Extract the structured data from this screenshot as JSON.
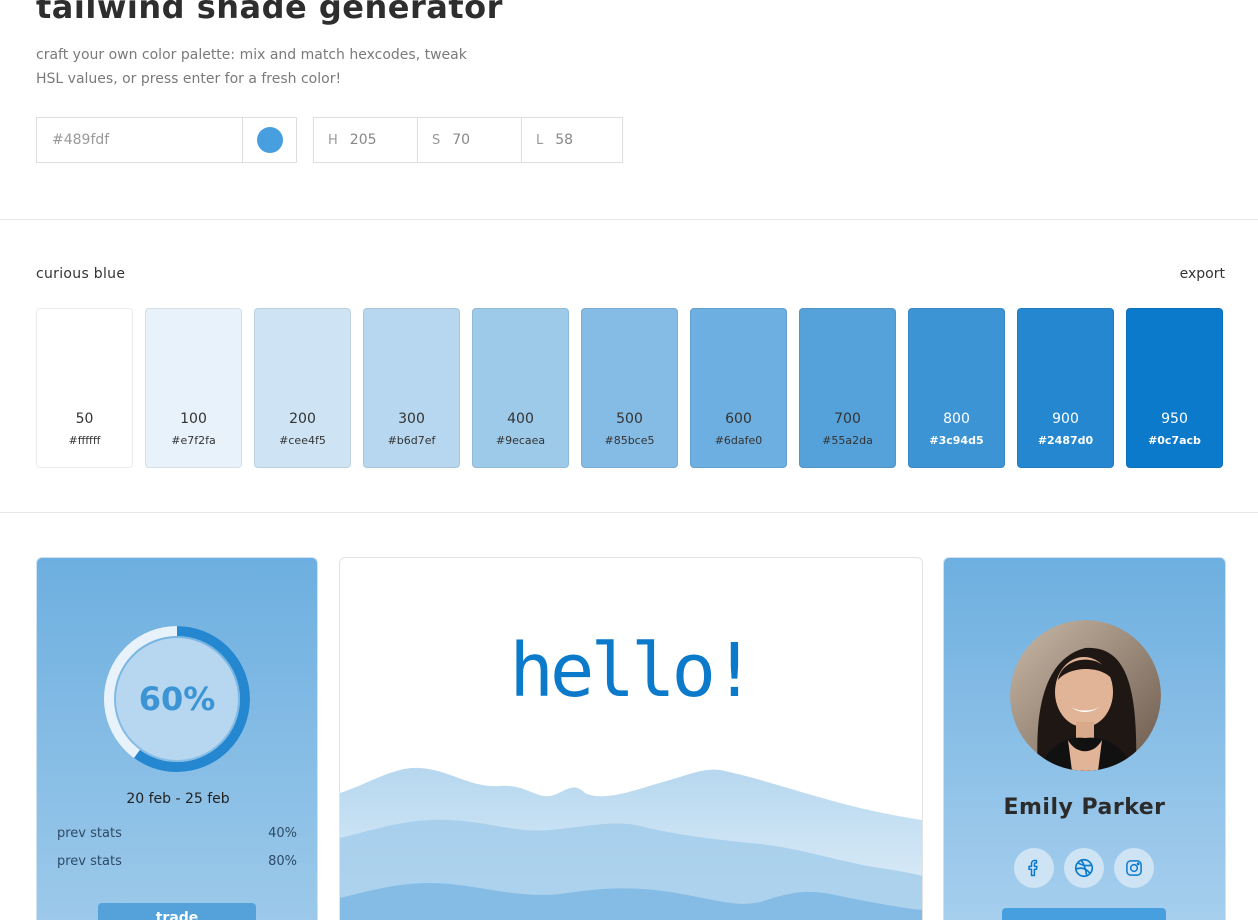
{
  "header": {
    "title": "tailwind shade generator",
    "subtitle": "craft your own color palette: mix and match hexcodes, tweak HSL values, or press enter for a fresh color!"
  },
  "controls": {
    "hex_placeholder": "#489fdf",
    "swatch_color": "#489fdf",
    "hsl": {
      "h_label": "H",
      "h_value": "205",
      "s_label": "S",
      "s_value": "70",
      "l_label": "L",
      "l_value": "58"
    }
  },
  "palette": {
    "name": "curious blue",
    "export_label": "export",
    "shades": [
      {
        "num": "50",
        "hex": "#ffffff"
      },
      {
        "num": "100",
        "hex": "#e7f2fa"
      },
      {
        "num": "200",
        "hex": "#cee4f5"
      },
      {
        "num": "300",
        "hex": "#b6d7ef"
      },
      {
        "num": "400",
        "hex": "#9ecaea"
      },
      {
        "num": "500",
        "hex": "#85bce5"
      },
      {
        "num": "600",
        "hex": "#6dafe0"
      },
      {
        "num": "700",
        "hex": "#55a2da"
      },
      {
        "num": "800",
        "hex": "#3c94d5"
      },
      {
        "num": "900",
        "hex": "#2487d0"
      },
      {
        "num": "950",
        "hex": "#0c7acb"
      }
    ]
  },
  "stats_card": {
    "progress_text": "60%",
    "progress_fraction": 0.6,
    "date_range": "20 feb - 25 feb",
    "rows": [
      {
        "label": "prev stats",
        "value": "40%"
      },
      {
        "label": "prev stats",
        "value": "80%"
      }
    ],
    "button_label": "trade"
  },
  "hello_card": {
    "text": "hello!"
  },
  "profile_card": {
    "name": "Emily Parker",
    "socials": [
      "facebook-icon",
      "dribbble-icon",
      "instagram-icon"
    ]
  }
}
